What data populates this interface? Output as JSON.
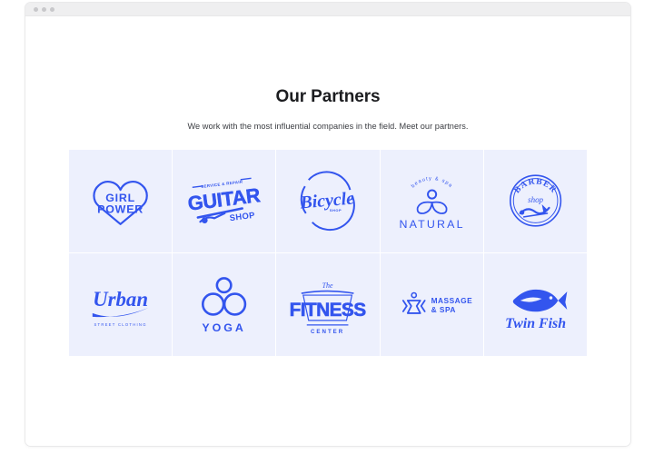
{
  "window": {
    "dots": [
      "window-dot-1",
      "window-dot-2",
      "window-dot-3"
    ],
    "chrome_color": "#efeff0"
  },
  "section": {
    "title": "Our Partners",
    "subtitle": "We work with the most influential companies in the field. Meet our partners."
  },
  "theme": {
    "logo_blue": "#3355ee",
    "cell_background": "#edf0fd",
    "page_background": "#ffffff",
    "title_color": "#1c1d20"
  },
  "grid": {
    "columns": 5,
    "rows": 2,
    "cells": [
      {
        "id": "girl-power",
        "name": "Girl Power",
        "icon": "heart-outline-icon",
        "line1": "GIRL",
        "line2": "POWER"
      },
      {
        "id": "guitar-shop",
        "name": "Guitar Shop",
        "icon": "guitar-icon",
        "line1": "SERVICE & REPAIR",
        "line2": "GUITAR",
        "line3": "SHOP"
      },
      {
        "id": "bicycle-shop",
        "name": "Bicycle Shop",
        "icon": "bicycle-circle-icon",
        "line1": "Bicycle",
        "line2": "SHOP"
      },
      {
        "id": "natural-beauty-spa",
        "name": "Natural",
        "icon": "leaf-person-icon",
        "line1": "beauty & spa",
        "line2": "NATURAL"
      },
      {
        "id": "barber-shop",
        "name": "Barber Shop",
        "icon": "barber-badge-icon",
        "line1": "BARBER",
        "line2": "shop"
      },
      {
        "id": "urban-street-clothing",
        "name": "Urban Street Clothing",
        "icon": "urban-script-icon",
        "line1": "Urban",
        "line2": "STREET CLOTHING"
      },
      {
        "id": "yoga",
        "name": "Yoga",
        "icon": "three-circles-icon",
        "line1": "YOGA"
      },
      {
        "id": "the-fitness-center",
        "name": "The Fitness Center",
        "icon": "fitness-banner-icon",
        "line1": "The",
        "line2": "FITNESS",
        "line3": "CENTER"
      },
      {
        "id": "massage-and-spa",
        "name": "Massage & Spa",
        "icon": "massage-figure-icon",
        "line1": "MASSAGE",
        "line2": "& SPA"
      },
      {
        "id": "twin-fish",
        "name": "Twin Fish",
        "icon": "fish-icon",
        "line1": "Twin Fish"
      }
    ]
  }
}
